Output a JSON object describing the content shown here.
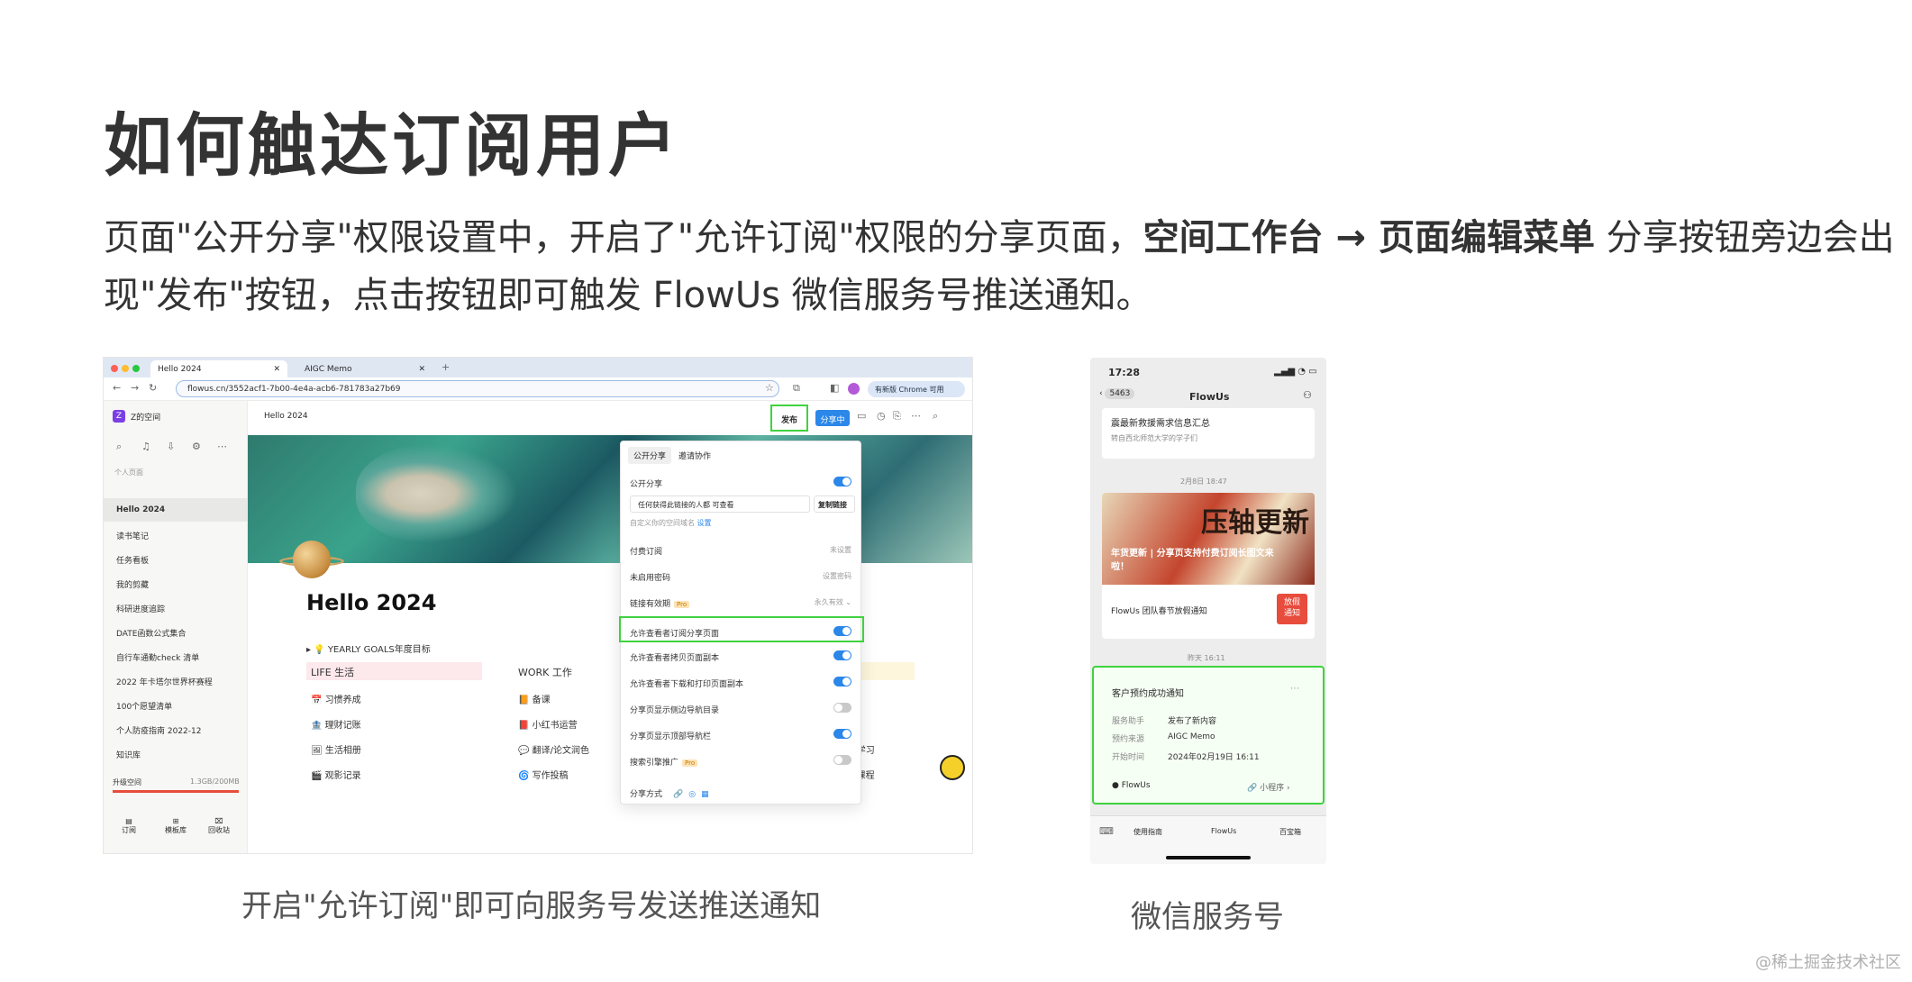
{
  "heading": "如何触达订阅用户",
  "para": {
    "part1": "页面\"公开分享\"权限设置中，开启了\"允许订阅\"权限的分享页面，",
    "bold1": "空间工作台 → 页面编辑菜单",
    "part2": " 分享按钮旁边会出现\"发布\"按钮，点击按钮即可触发 FlowUs 微信服务号推送通知。"
  },
  "captions": {
    "left": "开启\"允许订阅\"即可向服务号发送推送通知",
    "right": "微信服务号"
  },
  "watermark": "@稀土掘金技术社区",
  "browser": {
    "tabs": [
      "Hello 2024",
      "AIGC Memo"
    ],
    "url": "flowus.cn/3552acf1-7b00-4e4a-acb6-781783a27b69",
    "chrome_update": "有新版 Chrome 可用",
    "workspace": "Z的空间",
    "section": "个人页面",
    "sidebar_items": [
      "Hello 2024",
      "读书笔记",
      "任务看板",
      "我的剪藏",
      "科研进度追踪",
      "DATE函数公式集合",
      "自行车通勤check 清单",
      "2022 年卡塔尔世界杯赛程",
      "100个愿望清单",
      "个人防疫指南 2022-12",
      "知识库"
    ],
    "storage_label": "升级空间",
    "storage_value": "1.3GB/200MB",
    "bottom_nav": [
      "订阅",
      "模板库",
      "回收站"
    ],
    "breadcrumb": "Hello 2024",
    "publish_btn": "发布",
    "sharing_btn": "分享中",
    "page_title": "Hello 2024",
    "yearly": "YEARLY GOALS年度目标",
    "columns": {
      "life": {
        "title": "LIFE 生活",
        "items": [
          "习惯养成",
          "理财记账",
          "生活相册",
          "观影记录"
        ]
      },
      "work": {
        "title": "WORK 工作",
        "items": [
          "备课",
          "小红书运营",
          "翻译/论文润色",
          "写作投稿"
        ]
      },
      "study": {
        "items": [
          "TED学习",
          "自学课程"
        ]
      }
    },
    "popup": {
      "tabs": [
        "公开分享",
        "邀请协作"
      ],
      "public_share": "公开分享",
      "access_select": "任何获得此链接的人都 可查看",
      "copy_link": "复制链接",
      "custom_domain": "自定义你的空间域名",
      "custom_domain_link": "设置",
      "rows": [
        {
          "label": "付费订阅",
          "value": "未设置"
        },
        {
          "label": "未启用密码",
          "value": "设置密码"
        },
        {
          "label": "链接有效期",
          "badge": "Pro",
          "value": "永久有效 ⌄"
        }
      ],
      "toggles": [
        {
          "label": "允许查看者订阅分享页面",
          "on": true
        },
        {
          "label": "允许查看者拷贝页面副本",
          "on": true
        },
        {
          "label": "允许查看者下载和打印页面副本",
          "on": true
        },
        {
          "label": "分享页显示侧边导航目录",
          "on": false
        },
        {
          "label": "分享页显示顶部导航栏",
          "on": true
        },
        {
          "label": "搜索引擎推广",
          "badge": "Pro",
          "on": false
        }
      ],
      "share_method": "分享方式"
    }
  },
  "phone": {
    "time": "17:28",
    "back_count": "5463",
    "title": "FlowUs",
    "top_text": "震最新救援需求信息汇总",
    "top_sub": "转自西北师范大学的学子们",
    "date1": "2月8日 18:47",
    "banner_text": "年货更新 | 分享页支持付费订阅长图文来啦！",
    "banner_big": "压轴更新",
    "item_text": "FlowUs 团队春节放假通知",
    "item_badge": "放假通知",
    "date2": "昨天 16:11",
    "notice": {
      "title": "客户预约成功通知",
      "rows": [
        {
          "k": "服务助手",
          "v": "发布了新内容"
        },
        {
          "k": "预约来源",
          "v": "AIGC Memo"
        },
        {
          "k": "开始时间",
          "v": "2024年02月19日 16:11"
        }
      ],
      "brand": "FlowUs",
      "miniapp": "小程序"
    },
    "menu": [
      "使用指南",
      "FlowUs",
      "百宝箱"
    ]
  }
}
